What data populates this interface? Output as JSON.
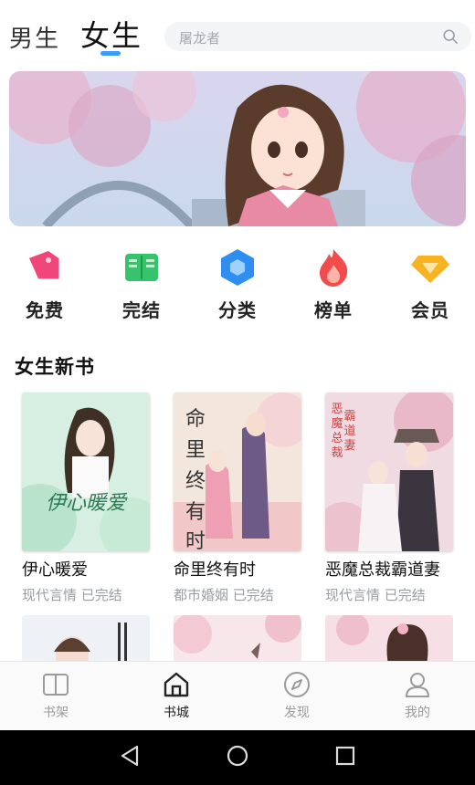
{
  "header": {
    "tabs": [
      {
        "label": "男生"
      },
      {
        "label": "女生"
      }
    ],
    "search_placeholder": "屠龙者"
  },
  "categories": [
    {
      "label": "免费",
      "icon": "tag-icon",
      "color": "#f0467a"
    },
    {
      "label": "完结",
      "icon": "book-open-icon",
      "color": "#35c46b"
    },
    {
      "label": "分类",
      "icon": "hexagon-icon",
      "color": "#2f8ff0"
    },
    {
      "label": "榜单",
      "icon": "flame-icon",
      "color": "#f24b4b"
    },
    {
      "label": "会员",
      "icon": "diamond-icon",
      "color": "#f7b322"
    }
  ],
  "section": {
    "title": "女生新书"
  },
  "books": [
    {
      "title": "伊心暖爱",
      "genre": "现代言情",
      "status": "已完结",
      "cover_text": "伊心暖爱"
    },
    {
      "title": "命里终有时",
      "genre": "都市婚姻",
      "status": "已完结",
      "cover_text": "命里终有时"
    },
    {
      "title": "恶魔总裁霸道妻",
      "genre": "现代言情",
      "status": "已完结",
      "cover_text": "恶魔总裁霸道妻"
    }
  ],
  "bottom_nav": [
    {
      "label": "书架",
      "icon": "bookshelf-icon"
    },
    {
      "label": "书城",
      "icon": "home-icon",
      "active": true
    },
    {
      "label": "发现",
      "icon": "compass-icon"
    },
    {
      "label": "我的",
      "icon": "user-icon"
    }
  ],
  "colors": {
    "accent": "#3a9bff",
    "muted": "#9a9ea4"
  }
}
